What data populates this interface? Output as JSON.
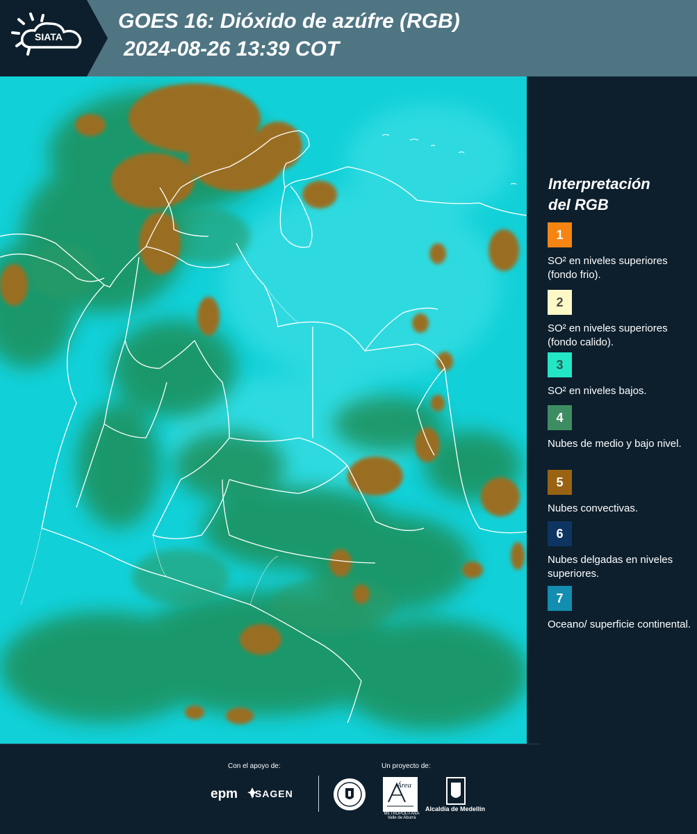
{
  "header": {
    "logo_text": "SIATA",
    "title_line1": "GOES 16: Dióxido de azúfre (RGB)",
    "title_line2": "2024-08-26 13:39 COT",
    "bg_color": "#4f7583"
  },
  "map": {
    "background_color": "#12d0d8",
    "cloud_color": "#1f8f5a",
    "convective_color": "#9a6e24",
    "border_color": "#ffffff"
  },
  "legend": {
    "title_line1": "Interpretación",
    "title_line2": "del RGB",
    "items": [
      {
        "number": "1",
        "color": "#f68412",
        "label": "SO² en niveles superiores (fondo frio)."
      },
      {
        "number": "2",
        "color": "#fdf9c7",
        "label": "SO² en niveles superiores (fondo calido)."
      },
      {
        "number": "3",
        "color": "#23e6c5",
        "label": "SO² en niveles bajos."
      },
      {
        "number": "4",
        "color": "#3e8d62",
        "label": "Nubes de medio y bajo nivel."
      },
      {
        "number": "5",
        "color": "#9a6313",
        "label": "Nubes convectivas."
      },
      {
        "number": "6",
        "color": "#0e3461",
        "label": "Nubes delgadas en niveles superiores."
      },
      {
        "number": "7",
        "color": "#138db0",
        "label": "Oceano/ superficie continental."
      }
    ]
  },
  "footer": {
    "support_label": "Con el apoyo de:",
    "project_label": "Un proyecto de:",
    "epm_logo": "epm",
    "isagen_logo": "ISAGEN",
    "area_logo": "Área",
    "area_subtitle": "METROPOLITANA Valle de Aburrá",
    "alcaldia_text": "Alcaldía de Medellín"
  }
}
